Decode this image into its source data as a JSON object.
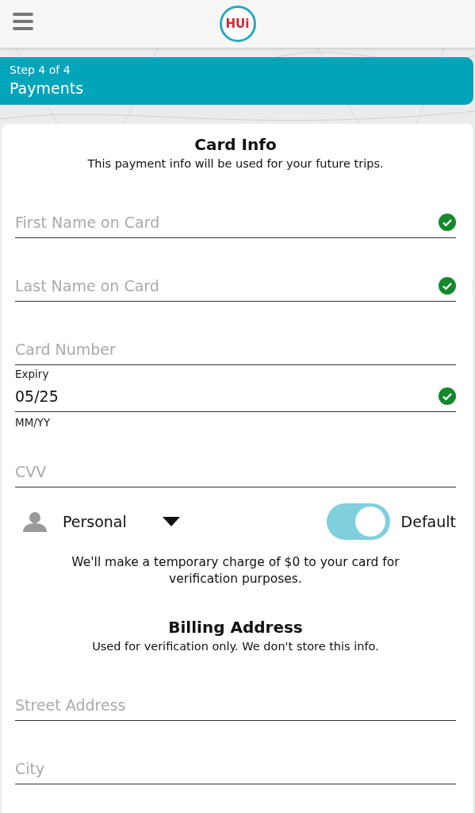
{
  "header": {
    "logo": "HUi"
  },
  "step": {
    "counter": "Step 4 of 4",
    "title": "Payments"
  },
  "card_info": {
    "title": "Card Info",
    "subtitle": "This payment info will be used for your future trips.",
    "fields": [
      {
        "placeholder": "First Name on Card",
        "valid": true
      },
      {
        "placeholder": "Last Name on Card",
        "valid": true
      },
      {
        "placeholder": "Card Number",
        "valid": false
      },
      {
        "label": "Expiry",
        "value": "05/25",
        "helper": "MM/YY",
        "valid": true
      },
      {
        "placeholder": "CVV",
        "valid": false
      }
    ],
    "card_type": {
      "value": "Personal"
    },
    "default_toggle": {
      "label": "Default",
      "on": true
    },
    "notice": "We'll make a temporary charge of $0 to your card for verification purposes."
  },
  "billing": {
    "title": "Billing Address",
    "subtitle": "Used for verification only. We don't store this info.",
    "fields": [
      {
        "placeholder": "Street Address",
        "valid": false
      },
      {
        "placeholder": "City",
        "valid": false
      }
    ]
  }
}
